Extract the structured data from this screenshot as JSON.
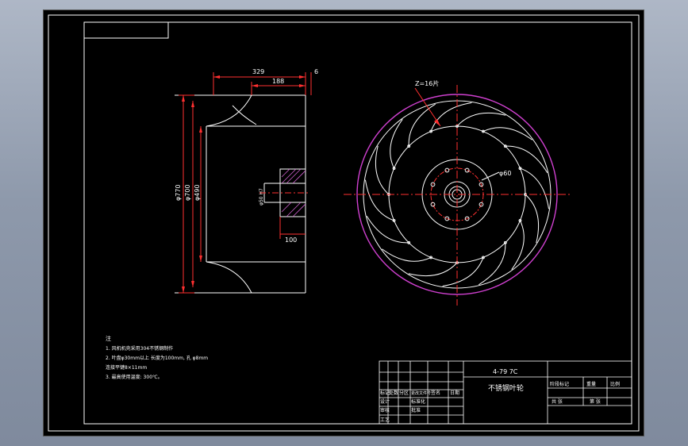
{
  "drawing": {
    "model": "4-79 7C",
    "part_name": "不锈钢叶轮",
    "blade_callout": "Z=16片",
    "bolt_callout": "φ60"
  },
  "dimensions": {
    "width_total": "329",
    "width_inner": "188",
    "offset": "6",
    "hub_length": "100",
    "dia_outer": "φ770",
    "dia_mid": "φ700",
    "dia_inlet": "φ490",
    "hub_bore": "φ50 H7"
  },
  "notes": {
    "title": "注",
    "line1": "1. 风机机壳采用304不锈钢制作",
    "line2": "2. 叶盘φ30mm以上  长度为100mm, 孔 φ8mm",
    "line3": "   连接平键8×11mm",
    "line4": "3. 最高使用温度: 300℃。"
  },
  "title_block": {
    "col_mark": "标记",
    "col_count": "处数",
    "col_zone": "分区",
    "col_docno": "更改文件号",
    "col_sign": "签名",
    "col_date": "日期",
    "row_design": "设计",
    "row_check": "审核",
    "row_craft": "工艺",
    "std": "标准化",
    "approve": "批准",
    "stage_label": "阶段标记",
    "weight_label": "重量",
    "scale_label": "比例",
    "sheets": "共    张",
    "sheet_no": "第    张"
  },
  "colors": {
    "background": "#000000",
    "frame_lines": "#ffffff",
    "dimension": "#ff3030",
    "centerline": "#ff3030",
    "impeller_outer": "#d040d0",
    "hatch": "#d060d0"
  }
}
